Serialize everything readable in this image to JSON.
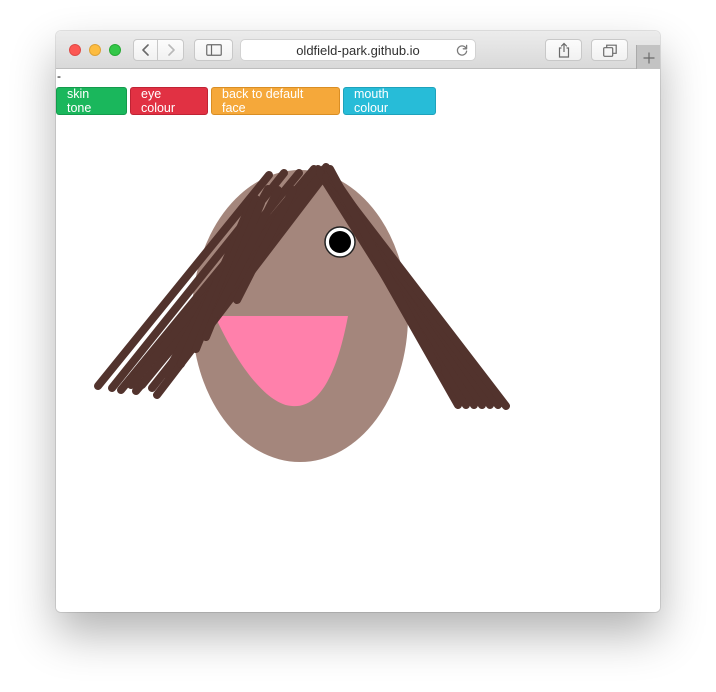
{
  "browser": {
    "url": "oldfield-park.github.io"
  },
  "page": {
    "stray_text": "-",
    "buttons": {
      "skin_tone": "skin tone",
      "eye_colour": "eye colour",
      "default_face": "back to default face",
      "mouth_colour": "mouth colour"
    }
  },
  "colors": {
    "skin": "#a4867c",
    "mouth": "#ff80ab",
    "hair": "#52332d",
    "eye_white": "#ffffff",
    "pupil": "#000000",
    "btn_skin": "#1ab75c",
    "btn_eye": "#e13143",
    "btn_reset": "#f5a83a",
    "btn_mouth": "#27bcd8"
  },
  "icons": {
    "close": "traffic-light-close",
    "minimize": "traffic-light-minimize",
    "maximize": "traffic-light-maximize",
    "back": "chevron-left-icon",
    "forward": "chevron-right-icon",
    "sidebar": "sidebar-icon",
    "reload": "reload-icon",
    "share": "share-icon",
    "tabs": "tabs-overview-icon",
    "new_tab": "plus-icon"
  }
}
